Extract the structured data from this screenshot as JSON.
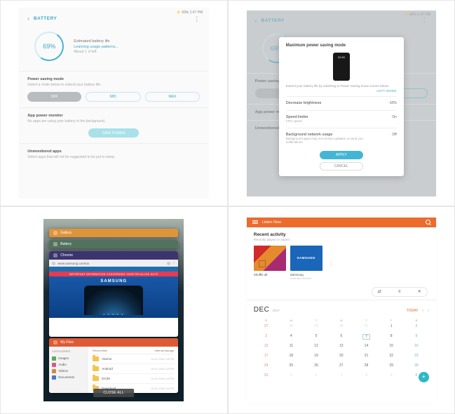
{
  "p1": {
    "status_bar": "⚡ 69% 1:47 PM",
    "title": "BATTERY",
    "battery_pct": "69%",
    "hero_line1": "Estimated battery life",
    "hero_line2": "Learning usage patterns...",
    "hero_line3": "About 1 d left",
    "sec1_title": "Power saving mode",
    "sec1_sub": "Select a mode below to extend your battery life.",
    "seg_off": "OFF",
    "seg_mid": "MID",
    "seg_max": "MAX",
    "sec2_title": "App power monitor",
    "sec2_sub": "No apps are using your battery in the background.",
    "sec2_btn": "SAVE POWER",
    "sec3_title": "Unmonitored apps",
    "sec3_sub": "Select apps that will not be suggested to be put to sleep."
  },
  "p2": {
    "modal_title": "Maximum power saving mode",
    "phone_time": "12:45",
    "desc": "Extend your battery life by switching to Power Saving home screen below.",
    "link": "LEFT MODE",
    "row1_label": "Decrease brightness",
    "row1_val": "-10%",
    "row2_label": "Speed limiter",
    "row2_sub": "CPU speed",
    "row2_val": "On",
    "row3_label": "Background network usage",
    "row3_sub": "Background apps may not receive updates or send you notifications.",
    "row3_val": "Off",
    "apply": "APPLY",
    "cancel": "CANCEL"
  },
  "p3": {
    "card_gallery": "Gallery",
    "card_battery": "Battery",
    "card_chrome": "Chrome",
    "addr_url": "www.samsung.com/us",
    "banner": "IMPORTANT INFORMATION CONCERNING YOUR RECALLED NOTE",
    "samsung": "SAMSUNG",
    "card_files": "My Files",
    "cat": "CATEGORIES",
    "fs_images": "Images",
    "fs_audio": "Audio",
    "fs_videos": "Videos",
    "fs_documents": "Documents",
    "main_hdr_left": "Recent files",
    "main_hdr_right": "Internal storage",
    "rows": [
      {
        "name": "Alarms",
        "date": "Jul 15, 2016  1:40 PM"
      },
      {
        "name": "Android",
        "date": "Jul 15, 2016  1:40 PM"
      },
      {
        "name": "DCIM",
        "date": "Jul 15, 2016  1:40 PM"
      },
      {
        "name": "Download",
        "date": "Jul 15, 2016  1:40 PM"
      }
    ],
    "close_all": "CLOSE ALL"
  },
  "p4": {
    "app_title": "Listen Now",
    "sec_title": "Recent activity",
    "sec_sub": "Recently played or added",
    "card1_label": "Shuffle all",
    "card2_thumb": "SAMSUNG",
    "card2_label": "Samsung",
    "card2_sub": "Over the Horizon",
    "month": "DEC",
    "year": "2017",
    "today_label": "TODAY",
    "dow": [
      "S",
      "M",
      "T",
      "W",
      "T",
      "F",
      "S"
    ],
    "days": [
      {
        "n": "27",
        "cls": "other sun"
      },
      {
        "n": "28",
        "cls": "other"
      },
      {
        "n": "29",
        "cls": "other"
      },
      {
        "n": "30",
        "cls": "other"
      },
      {
        "n": "31",
        "cls": "other"
      },
      {
        "n": "1",
        "cls": ""
      },
      {
        "n": "2",
        "cls": "sat"
      },
      {
        "n": "3",
        "cls": "sun"
      },
      {
        "n": "4",
        "cls": ""
      },
      {
        "n": "5",
        "cls": ""
      },
      {
        "n": "6",
        "cls": ""
      },
      {
        "n": "7",
        "cls": "today"
      },
      {
        "n": "8",
        "cls": ""
      },
      {
        "n": "9",
        "cls": "sat"
      },
      {
        "n": "10",
        "cls": "sun"
      },
      {
        "n": "11",
        "cls": ""
      },
      {
        "n": "12",
        "cls": ""
      },
      {
        "n": "13",
        "cls": ""
      },
      {
        "n": "14",
        "cls": ""
      },
      {
        "n": "15",
        "cls": ""
      },
      {
        "n": "16",
        "cls": "sat"
      },
      {
        "n": "17",
        "cls": "sun"
      },
      {
        "n": "18",
        "cls": ""
      },
      {
        "n": "19",
        "cls": ""
      },
      {
        "n": "20",
        "cls": ""
      },
      {
        "n": "21",
        "cls": ""
      },
      {
        "n": "22",
        "cls": ""
      },
      {
        "n": "23",
        "cls": "sat"
      },
      {
        "n": "24",
        "cls": "sun"
      },
      {
        "n": "25",
        "cls": ""
      },
      {
        "n": "26",
        "cls": ""
      },
      {
        "n": "27",
        "cls": ""
      },
      {
        "n": "28",
        "cls": ""
      },
      {
        "n": "29",
        "cls": ""
      },
      {
        "n": "30",
        "cls": "sat"
      },
      {
        "n": "31",
        "cls": "sun"
      },
      {
        "n": "1",
        "cls": "other"
      },
      {
        "n": "2",
        "cls": "other"
      },
      {
        "n": "3",
        "cls": "other"
      },
      {
        "n": "4",
        "cls": "other"
      },
      {
        "n": "5",
        "cls": "other"
      },
      {
        "n": "6",
        "cls": "other sat"
      }
    ]
  }
}
